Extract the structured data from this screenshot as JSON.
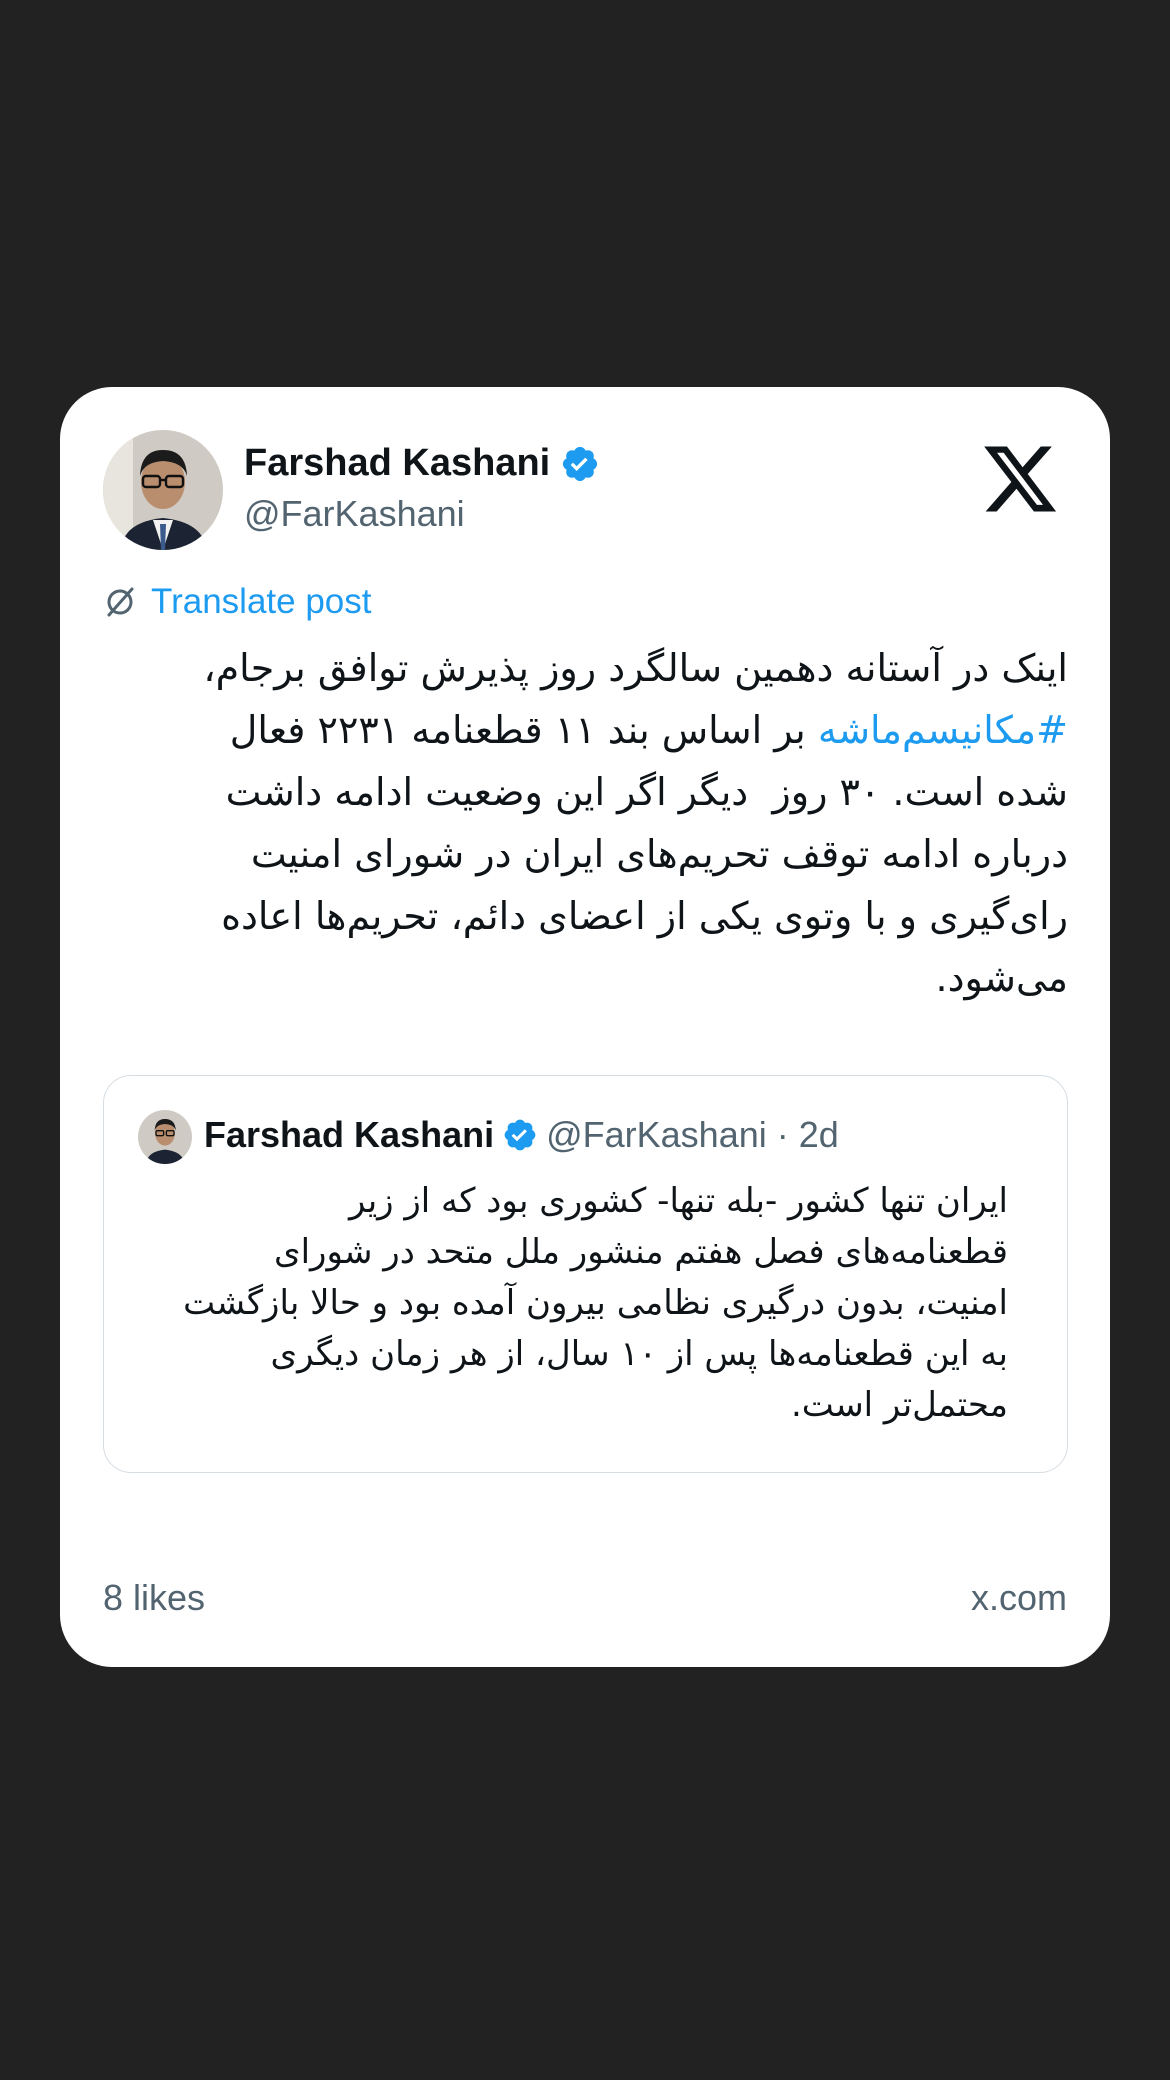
{
  "author": {
    "name": "Farshad Kashani",
    "handle": "@FarKashani"
  },
  "translate_label": "Translate post",
  "tweet": {
    "before_hashtag": "اینک در آستانه دهمین سالگرد روز پذیرش توافق برجام،\n",
    "hashtag": "#مکانیسم‌ماشه",
    "after_hashtag": " بر اساس بند ۱۱ قطعنامه ۲۲۳۱ فعال\nشده است. ۳۰ روز  دیگر اگر این وضعیت ادامه داشت\nدرباره ادامه توقف تحریم‌های ایران در شورای امنیت\nرای‌گیری و با وتوی یکی از اعضای دائم، تحریم‌ها اعاده\nمی‌شود."
  },
  "quoted": {
    "name": "Farshad Kashani",
    "handle_time": "@FarKashani · 2d",
    "text": "ایران تنها کشور -بله تنها- کشوری بود که از زیر\nقطعنامه‌های فصل هفتم منشور ملل متحد در شورای\nامنیت، بدون درگیری نظامی بیرون آمده بود و حالا بازگشت\nبه این قطعنامه‌ها پس از ۱۰ سال، از هر زمان دیگری\nمحتمل‌تر است."
  },
  "footer": {
    "likes": "8 likes",
    "domain": "x.com"
  },
  "colors": {
    "background": "#222222",
    "card": "#ffffff",
    "accent": "#1d9bf0",
    "secondary_text": "#536471"
  },
  "icons": [
    "avatar",
    "verified-badge-icon",
    "x-logo-icon",
    "translate-icon"
  ]
}
